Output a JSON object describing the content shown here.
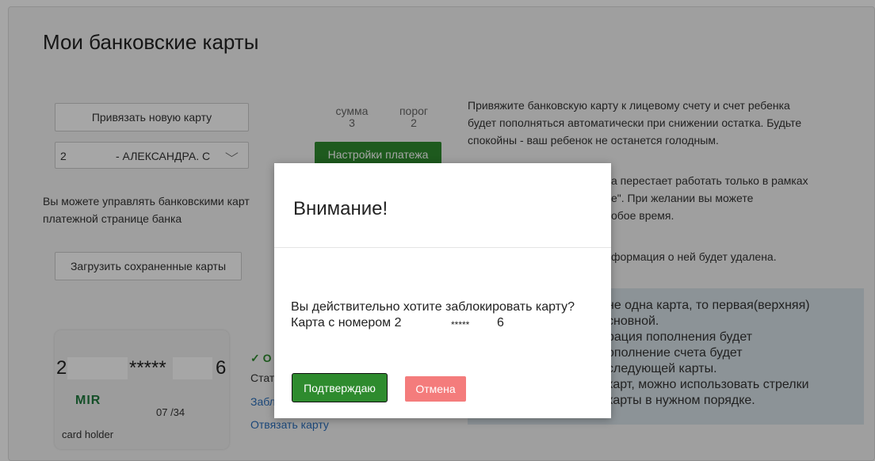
{
  "page": {
    "title": "Мои банковские карты"
  },
  "controls": {
    "bind_card_label": "Привязать новую карту",
    "card_select": {
      "prefix": "2",
      "holder_name": "- АЛЕКСАНДРА. С"
    },
    "load_saved_label": "Загрузить сохраненные карты"
  },
  "stats": {
    "sum_label": "сумма",
    "sum_value": "3",
    "threshold_label": "порог",
    "threshold_value": "2"
  },
  "payment_settings_label": "Настройки платежа",
  "descriptions": {
    "manage_line1": "Вы можете управлять банковскими карт",
    "manage_line2": "платежной странице банка",
    "bind_info_line1": "Привяжите банковскую карту к лицевому счету и счет ребенка",
    "bind_info_line2": "будет пополняться автоматически при снижении остатка. Будьте",
    "bind_info_line3": "спокойны - ваш ребенок не останется голодным.",
    "block_line1": "а перестает работать только в рамках",
    "block_line2": "е\". При желании вы можете",
    "block_line3": "обое время.",
    "unbind_line": "формация о ней будет удалена."
  },
  "card": {
    "number_prefix": "2",
    "number_stars": "*****",
    "number_suffix": "6",
    "brand": "MIR",
    "expiry": "07 /34",
    "holder": "card holder"
  },
  "card_actions": {
    "status_icon_text": "✓ О",
    "status_text": "Стат",
    "block_link": "Забл",
    "unbind_link": "Отвязать карту"
  },
  "info_box": {
    "line1": "не одна карта, то первая(верхняя)",
    "line2": "сновной.",
    "line3": "рация пополнения будет",
    "line4": "ополнение счета будет",
    "line5": "следующей карты.",
    "line6": "карт, можно использовать стрелки",
    "line7": "карты в нужном порядке."
  },
  "modal": {
    "title": "Внимание!",
    "question": "Вы действительно хотите заблокировать карту?",
    "card_number_prefix": "Карта с номером 2",
    "card_number_stars": "*****",
    "card_number_suffix": "6",
    "confirm_label": "Подтверждаю",
    "cancel_label": "Отмена"
  },
  "colors": {
    "accent_green": "#2e8b2e",
    "cancel_red": "#f47c7c",
    "link_blue": "#2a6ebb"
  }
}
